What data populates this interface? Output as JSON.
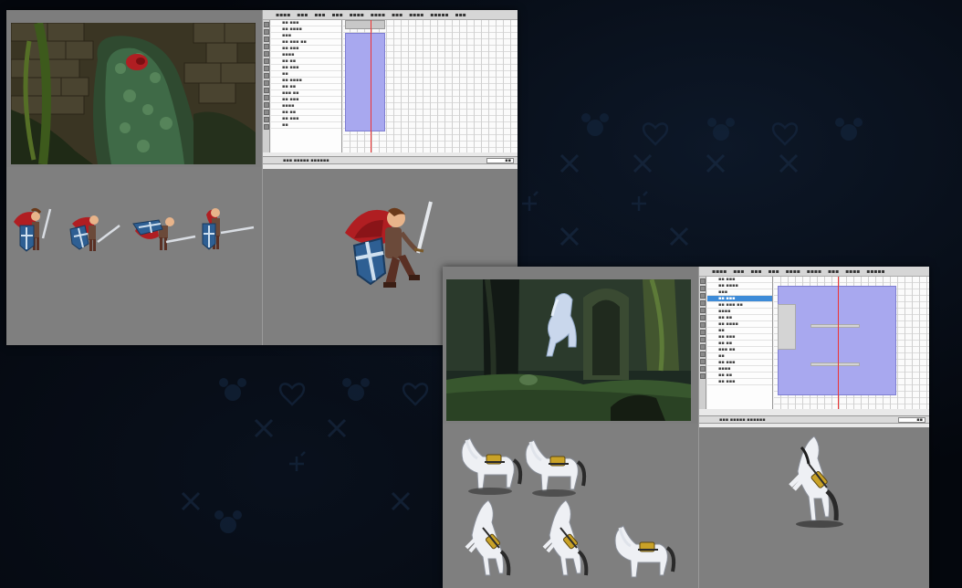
{
  "colors": {
    "background": "#04070d",
    "panel_gray": "#7f7f7f",
    "frame_blue": "#a8a8ef",
    "layer_select": "#3d8bd8",
    "prince_cape": "#b01e22",
    "shield_blue": "#2e5f93",
    "horse_white": "#eef0f4",
    "horse_saddle": "#c9a227"
  },
  "panels": [
    {
      "id": "prince",
      "scene": "castle-wall-thorn-dragon",
      "sprite_sheet": "prince-sword-shield-poses",
      "sprite_count": 4,
      "stage_sprite": "prince-leaping-with-sword",
      "layer_count": 17
    },
    {
      "id": "horse",
      "scene": "forest-horse-rearing",
      "sprite_sheet": "white-horse-poses",
      "sprite_count": 5,
      "stage_sprite": "horse-rearing",
      "layer_count": 17
    }
  ],
  "icons": [
    "mickey-head-icon",
    "crown-icon",
    "heart-icon",
    "x-cross-icon"
  ]
}
